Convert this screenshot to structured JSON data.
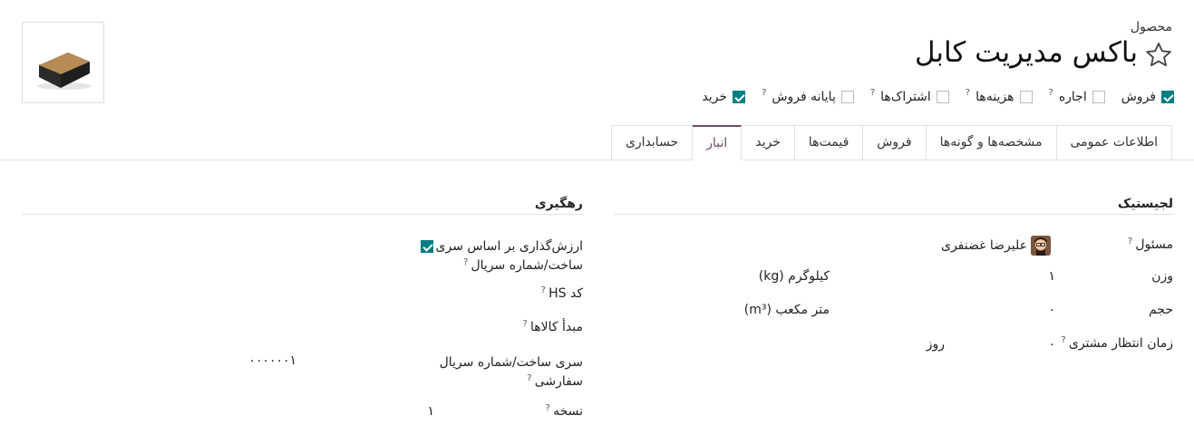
{
  "header": {
    "breadcrumb": "محصول",
    "title": "باکس مدیریت کابل"
  },
  "options": [
    {
      "label": "فروش",
      "checked": true,
      "help": false
    },
    {
      "label": "اجاره",
      "checked": false,
      "help": true
    },
    {
      "label": "هزینه‌ها",
      "checked": false,
      "help": true
    },
    {
      "label": "اشتراک‌ها",
      "checked": false,
      "help": true
    },
    {
      "label": "پایانه فروش",
      "checked": false,
      "help": true
    },
    {
      "label": "خرید",
      "checked": true,
      "help": false
    }
  ],
  "tabs": [
    "اطلاعات عمومی",
    "مشخصه‌ها و گونه‌ها",
    "فروش",
    "قیمت‌ها",
    "خرید",
    "انبار",
    "حسابداری"
  ],
  "active_tab": "انبار",
  "logistics": {
    "title": "لجیستیک",
    "responsible_label": "مسئول",
    "responsible_value": "علیرضا غضنفری",
    "weight_label": "وزن",
    "weight_value": "۱",
    "weight_unit": "کیلوگرم (kg)",
    "volume_label": "حجم",
    "volume_value": "۰",
    "volume_unit": "متر مکعب (m³)",
    "lead_label": "زمان انتظار مشتری",
    "lead_value": "۰",
    "lead_unit": "روز"
  },
  "tracking": {
    "title": "رهگیری",
    "valuation_label_1": "ارزش‌گذاری بر اساس سری",
    "valuation_label_2": "ساخت/شماره سریال",
    "valuation_checked": true,
    "hs_label": "کد HS",
    "origin_label": "مبدأ کالاها",
    "custom_serial_label_1": "سری ساخت/شماره سریال",
    "custom_serial_label_2": "سفارشی",
    "custom_serial_value": "۰۰۰۰۰۰۱",
    "version_label": "نسخه",
    "version_value": "۱"
  },
  "colors": {
    "accent": "#017e84",
    "tab_active": "#714b67"
  },
  "icons": [
    "star-icon",
    "question-icon",
    "checkbox-icon",
    "avatar-icon"
  ]
}
